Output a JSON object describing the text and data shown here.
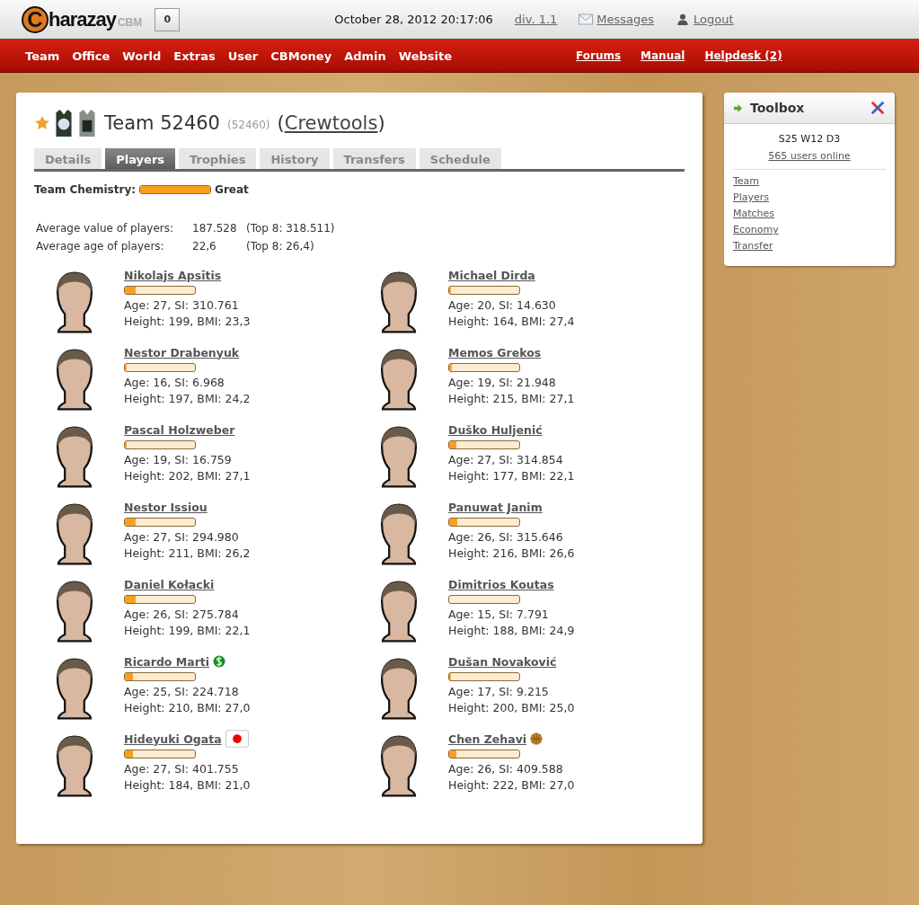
{
  "header": {
    "logo": {
      "mark": "C",
      "name": "harazay",
      "suffix": "CBM"
    },
    "counter": "0",
    "datetime": "October 28, 2012 20:17:06",
    "division": "div. 1.1",
    "messages": "Messages",
    "logout": "Logout"
  },
  "nav": {
    "left": [
      "Team",
      "Office",
      "World",
      "Extras",
      "User",
      "CBMoney",
      "Admin",
      "Website"
    ],
    "right": [
      "Forums",
      "Manual",
      "Helpdesk (2)"
    ]
  },
  "team": {
    "name": "Team 52460",
    "id": "(52460)",
    "open": "(",
    "owner": "Crewtools",
    "close": ")"
  },
  "tabs": [
    {
      "label": "Details",
      "selected": false
    },
    {
      "label": "Players",
      "selected": true
    },
    {
      "label": "Trophies",
      "selected": false
    },
    {
      "label": "History",
      "selected": false
    },
    {
      "label": "Transfers",
      "selected": false
    },
    {
      "label": "Schedule",
      "selected": false
    }
  ],
  "chemistry": {
    "label": "Team Chemistry:",
    "level": 1.0,
    "value": "Great"
  },
  "averages": [
    {
      "label": "Average value of players:",
      "value": "187.528",
      "top": "(Top 8: 318.511)"
    },
    {
      "label": "Average age of players:",
      "value": "22,6",
      "top": "(Top 8: 26,4)"
    }
  ],
  "players": [
    {
      "name": "Nikolajs Apsītis",
      "level": 0.15,
      "age_si": "Age: 27, SI: 310.761",
      "height_bmi": "Height: 199, BMI: 23,3"
    },
    {
      "name": "Michael Dirda",
      "level": 0.02,
      "age_si": "Age: 20, SI: 14.630",
      "height_bmi": "Height: 164, BMI: 27,4"
    },
    {
      "name": "Nestor Drabenyuk",
      "level": 0.02,
      "age_si": "Age: 16, SI: 6.968",
      "height_bmi": "Height: 197, BMI: 24,2"
    },
    {
      "name": "Memos Grekos",
      "level": 0.04,
      "age_si": "Age: 19, SI: 21.948",
      "height_bmi": "Height: 215, BMI: 27,1"
    },
    {
      "name": "Pascal Holzweber",
      "level": 0.03,
      "age_si": "Age: 19, SI: 16.759",
      "height_bmi": "Height: 202, BMI: 27,1"
    },
    {
      "name": "Duško Huljenić",
      "level": 0.1,
      "age_si": "Age: 27, SI: 314.854",
      "height_bmi": "Height: 177, BMI: 22,1"
    },
    {
      "name": "Nestor Issiou",
      "level": 0.15,
      "age_si": "Age: 27, SI: 294.980",
      "height_bmi": "Height: 211, BMI: 26,2"
    },
    {
      "name": "Panuwat Janim",
      "level": 0.12,
      "age_si": "Age: 26, SI: 315.646",
      "height_bmi": "Height: 216, BMI: 26,6"
    },
    {
      "name": "Daniel Kołacki",
      "level": 0.16,
      "age_si": "Age: 26, SI: 275.784",
      "height_bmi": "Height: 199, BMI: 22,1"
    },
    {
      "name": "Dimitrios Koutas",
      "level": 0.0,
      "age_si": "Age: 15, SI: 7.791",
      "height_bmi": "Height: 188, BMI: 24,9"
    },
    {
      "name": "Ricardo Marti",
      "kind": "dollar",
      "level": 0.12,
      "age_si": "Age: 25, SI: 224.718",
      "height_bmi": "Height: 210, BMI: 27,0"
    },
    {
      "name": "Dušan Novaković",
      "level": 0.03,
      "age_si": "Age: 17, SI: 9.215",
      "height_bmi": "Height: 200, BMI: 25,0"
    },
    {
      "name": "Hideyuki Ogata",
      "kind": "flag",
      "level": 0.12,
      "age_si": "Age: 27, SI: 401.755",
      "height_bmi": "Height: 184, BMI: 21,0"
    },
    {
      "name": "Chen Zehavi",
      "kind": "ball",
      "level": 0.1,
      "age_si": "Age: 26, SI: 409.588",
      "height_bmi": "Height: 222, BMI: 27,0"
    }
  ],
  "toolbox": {
    "title": "Toolbox",
    "date": "S25 W12 D3",
    "online": "565 users online",
    "links": [
      "Team",
      "Players",
      "Matches",
      "Economy",
      "Transfer"
    ]
  }
}
